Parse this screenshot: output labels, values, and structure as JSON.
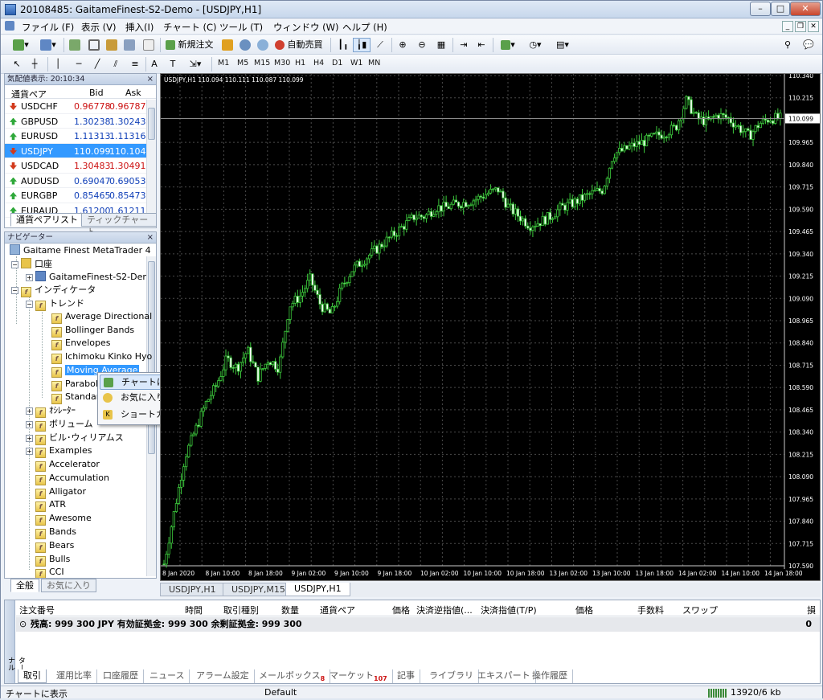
{
  "window": {
    "title": "20108485: GaitameFinest-S2-Demo - [USDJPY,H1]"
  },
  "menu": [
    "ファイル (F)",
    "表示 (V)",
    "挿入(I)",
    "チャート (C)",
    "ツール (T)",
    "ウィンドウ (W)",
    "ヘルプ (H)"
  ],
  "toolbar": {
    "new_order": "新規注文",
    "auto_trade": "自動売買",
    "timeframes": [
      "M1",
      "M5",
      "M15",
      "M30",
      "H1",
      "H4",
      "D1",
      "W1",
      "MN"
    ]
  },
  "market_watch": {
    "header": "気配値表示: 20:10:34",
    "columns": {
      "symbol": "通貨ペア",
      "bid": "Bid",
      "ask": "Ask"
    },
    "rows": [
      {
        "symbol": "USDCHF",
        "bid": "0.96778",
        "ask": "0.96787",
        "dir": "dn"
      },
      {
        "symbol": "GBPUSD",
        "bid": "1.30238",
        "ask": "1.30243",
        "dir": "up"
      },
      {
        "symbol": "EURUSD",
        "bid": "1.11313",
        "ask": "1.11316",
        "dir": "up"
      },
      {
        "symbol": "USDJPY",
        "bid": "110.099",
        "ask": "110.104",
        "dir": "dn"
      },
      {
        "symbol": "USDCAD",
        "bid": "1.30483",
        "ask": "1.30491",
        "dir": "dn"
      },
      {
        "symbol": "AUDUSD",
        "bid": "0.69047",
        "ask": "0.69053",
        "dir": "up"
      },
      {
        "symbol": "EURGBP",
        "bid": "0.85465",
        "ask": "0.85473",
        "dir": "up"
      },
      {
        "symbol": "EURAUD",
        "bid": "1.61200",
        "ask": "1.61211",
        "dir": "up"
      }
    ],
    "tabs": [
      "通貨ペアリスト",
      "ティックチャート"
    ]
  },
  "navigator": {
    "header": "ナビゲーター",
    "root": "Gaitame Finest MetaTrader 4",
    "account_folder": "口座",
    "account": "GaitameFinest-S2-Demo",
    "indicators": "インディケータ",
    "trend": "トレンド",
    "trend_items": [
      "Average Directional",
      "Bollinger Bands",
      "Envelopes",
      "Ichimoku Kinko Hyo",
      "Moving Average",
      "Parabolic",
      "Standard"
    ],
    "groups": [
      "ｵｼﾚｰﾀｰ",
      "ボリューム",
      "ビル･ウィリアムス",
      "Examples"
    ],
    "custom": [
      "Accelerator",
      "Accumulation",
      "Alligator",
      "ATR",
      "Awesome",
      "Bands",
      "Bears",
      "Bulls",
      "CCI"
    ],
    "tabs": [
      "全般",
      "お気に入り"
    ]
  },
  "context_menu": [
    "チャートに表示 (A)",
    "お気に入りに追加 (f)",
    "ショートカット設定 (S)"
  ],
  "chart": {
    "header": "USDJPY,H1  110.094 110.111 110.087 110.099",
    "current_price": "110.099",
    "price_labels": [
      "110.340",
      "110.215",
      "110.099",
      "109.965",
      "109.840",
      "109.715",
      "109.590",
      "109.465",
      "109.340",
      "109.215",
      "109.090",
      "108.965",
      "108.840",
      "108.715",
      "108.590",
      "108.465",
      "108.340",
      "108.215",
      "108.090",
      "107.965",
      "107.840",
      "107.715",
      "107.590"
    ],
    "time_labels": [
      "8 Jan 2020",
      "8 Jan 10:00",
      "8 Jan 18:00",
      "9 Jan 02:00",
      "9 Jan 10:00",
      "9 Jan 18:00",
      "10 Jan 02:00",
      "10 Jan 10:00",
      "10 Jan 18:00",
      "13 Jan 02:00",
      "13 Jan 10:00",
      "13 Jan 18:00",
      "14 Jan 02:00",
      "14 Jan 10:00",
      "14 Jan 18:00"
    ],
    "tabs": [
      "USDJPY,H1",
      "USDJPY,M15",
      "USDJPY,H1"
    ]
  },
  "chart_data": {
    "type": "candlestick",
    "symbol": "USDJPY",
    "timeframe": "H1",
    "ylim": [
      107.59,
      110.34
    ],
    "close_path": [
      107.6,
      107.9,
      108.2,
      108.35,
      108.5,
      108.6,
      108.75,
      108.7,
      108.8,
      108.65,
      108.75,
      108.7,
      109.05,
      109.1,
      109.2,
      109.05,
      109.0,
      109.15,
      109.25,
      109.3,
      109.35,
      109.4,
      109.45,
      109.5,
      109.55,
      109.55,
      109.6,
      109.6,
      109.62,
      109.63,
      109.65,
      109.68,
      109.7,
      109.6,
      109.55,
      109.5,
      109.52,
      109.55,
      109.6,
      109.62,
      109.65,
      109.68,
      109.7,
      109.9,
      109.92,
      109.95,
      109.97,
      110.0,
      110.02,
      110.05,
      110.2,
      110.1,
      110.08,
      110.12,
      110.1,
      110.05,
      110.0,
      110.07,
      110.1,
      110.1
    ]
  },
  "terminal": {
    "side": "ターミナル",
    "columns": [
      "注文番号",
      "時間",
      "取引種別",
      "数量",
      "通貨ペア",
      "価格",
      "決済逆指値(...",
      "決済指値(T/P)",
      "価格",
      "手数料",
      "スワップ",
      "損益"
    ],
    "balance": "残高: 999 300 JPY  有効証拠金: 999 300  余剰証拠金: 999 300",
    "profit": "0",
    "tabs": [
      {
        "label": "取引"
      },
      {
        "label": "運用比率"
      },
      {
        "label": "口座履歴"
      },
      {
        "label": "ニュース"
      },
      {
        "label": "アラーム設定"
      },
      {
        "label": "メールボックス",
        "badge": "8"
      },
      {
        "label": "マーケット",
        "badge": "107"
      },
      {
        "label": "記事"
      },
      {
        "label": "ライブラリ"
      },
      {
        "label": "エキスパート"
      },
      {
        "label": "操作履歴"
      }
    ]
  },
  "status": {
    "left": "チャートに表示",
    "mid": "Default",
    "right": "13920/6 kb"
  }
}
